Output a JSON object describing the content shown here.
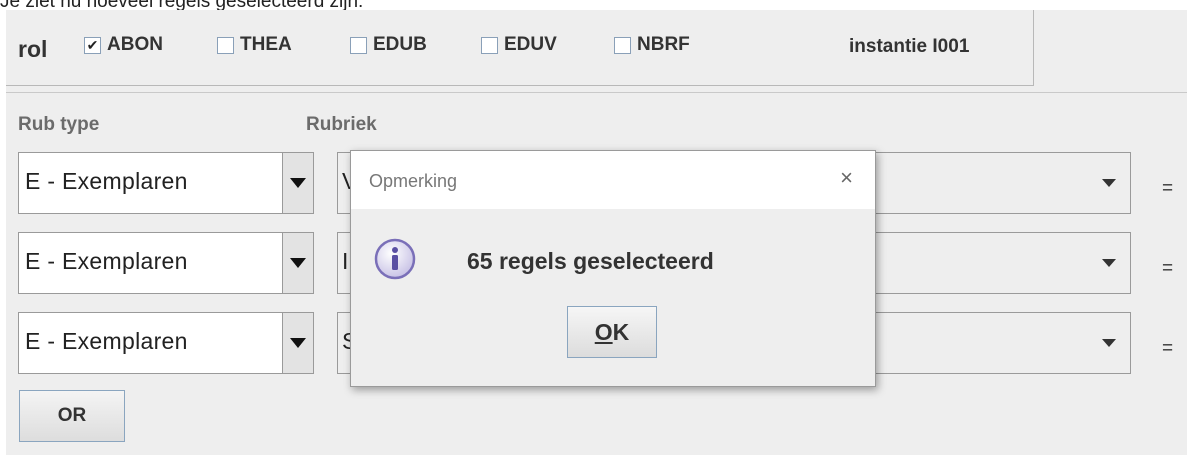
{
  "caption": "Je ziet nu hoeveel regels geselecteerd zijn:",
  "rol": {
    "label": "rol",
    "options": [
      {
        "label": "ABON",
        "checked": true
      },
      {
        "label": "THEA",
        "checked": false
      },
      {
        "label": "EDUB",
        "checked": false
      },
      {
        "label": "EDUV",
        "checked": false
      },
      {
        "label": "NBRF",
        "checked": false
      }
    ],
    "instantie": "instantie I001"
  },
  "columns": {
    "rub_type": "Rub type",
    "rubriek": "Rubriek"
  },
  "rows": [
    {
      "rub_type": "E - Exemplaren",
      "rubriek_visible": "V",
      "operator": "="
    },
    {
      "rub_type": "E - Exemplaren",
      "rubriek_visible": "I",
      "operator": "="
    },
    {
      "rub_type": "E - Exemplaren",
      "rubriek_visible": "S",
      "operator": "="
    }
  ],
  "or_button": "OR",
  "dialog": {
    "title": "Opmerking",
    "close_icon": "×",
    "icon": "info-icon",
    "message": "65 regels geselecteerd",
    "ok_mnemonic": "O",
    "ok_rest": "K"
  }
}
